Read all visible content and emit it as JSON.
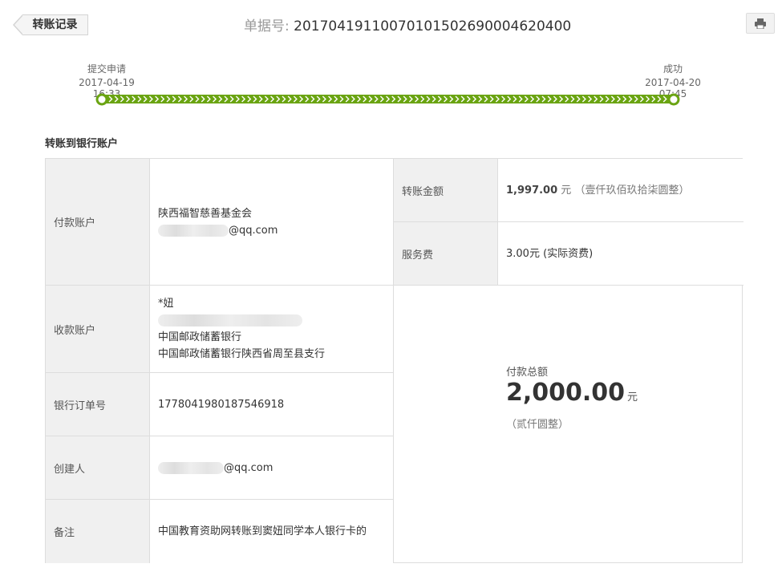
{
  "header": {
    "back_label": "转账记录",
    "doc_no_label": "单据号:",
    "doc_no_value": "20170419110070101502690004620400",
    "print_icon": "printer-icon"
  },
  "progress": {
    "start_label": "提交申请",
    "start_time": "2017-04-19 16:33",
    "end_label": "成功",
    "end_time": "2017-04-20 07:45",
    "accent": "#6aa412"
  },
  "section": {
    "title": "转账到银行账户"
  },
  "details": {
    "payer_label": "付款账户",
    "payer_name": "陕西福智慈善基金会",
    "payer_email_suffix": "@qq.com",
    "payee_label": "收款账户",
    "payee_name": "*妞",
    "payee_bank": "中国邮政储蓄银行",
    "payee_branch": "中国邮政储蓄银行陕西省周至县支行",
    "order_label": "银行订单号",
    "order_value": "1778041980187546918",
    "creator_label": "创建人",
    "creator_email_suffix": "@qq.com",
    "note_label": "备注",
    "note_value": "中国教育资助网转账到窦妞同学本人银行卡的",
    "amount_label": "转账金额",
    "amount_value": "1,997.00",
    "amount_unit": "元",
    "amount_caps": "（壹仟玖佰玖拾柒圆整）",
    "fee_label": "服务费",
    "fee_value": "3.00元 (实际资费)",
    "total_label": "付款总额",
    "total_value": "2,000.00",
    "total_unit": "元",
    "total_caps": "（贰仟圆整）"
  }
}
